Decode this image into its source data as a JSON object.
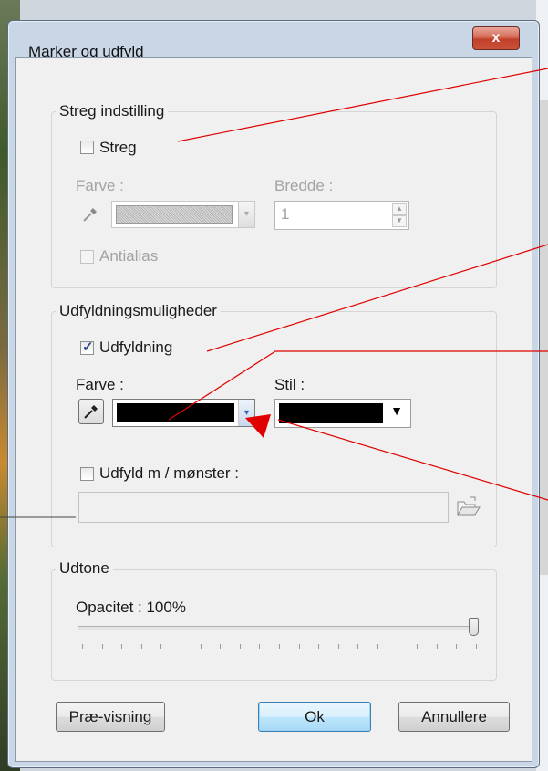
{
  "dialog": {
    "title": "Marker og udfyld",
    "close_label": "x"
  },
  "stroke_group": {
    "label": "Streg indstilling",
    "stroke_checkbox": {
      "label": "Streg",
      "checked": false
    },
    "color_label": "Farve :",
    "width_label": "Bredde :",
    "width_value": "1",
    "antialias_checkbox": {
      "label": "Antialias",
      "checked": false,
      "enabled": false
    }
  },
  "fill_group": {
    "label": "Udfyldningsmuligheder",
    "fill_checkbox": {
      "label": "Udfyldning",
      "checked": true
    },
    "color_label": "Farve :",
    "style_label": "Stil :",
    "fill_color": "#000000",
    "style_color": "#000000",
    "pattern_checkbox": {
      "label": "Udfyld m / mønster :",
      "checked": false
    },
    "pattern_path": ""
  },
  "fade_group": {
    "label": "Udtone",
    "opacity_label": "Opacitet : 100%",
    "opacity_value": 100
  },
  "buttons": {
    "preview": "Præ-visning",
    "ok": "Ok",
    "cancel": "Annullere"
  },
  "colors": {
    "annotation_arrow": "#e00000",
    "close_button": "#c7432c"
  },
  "icons": [
    "eyedropper-icon",
    "dropdown-arrow-icon",
    "folder-open-icon",
    "close-icon"
  ]
}
